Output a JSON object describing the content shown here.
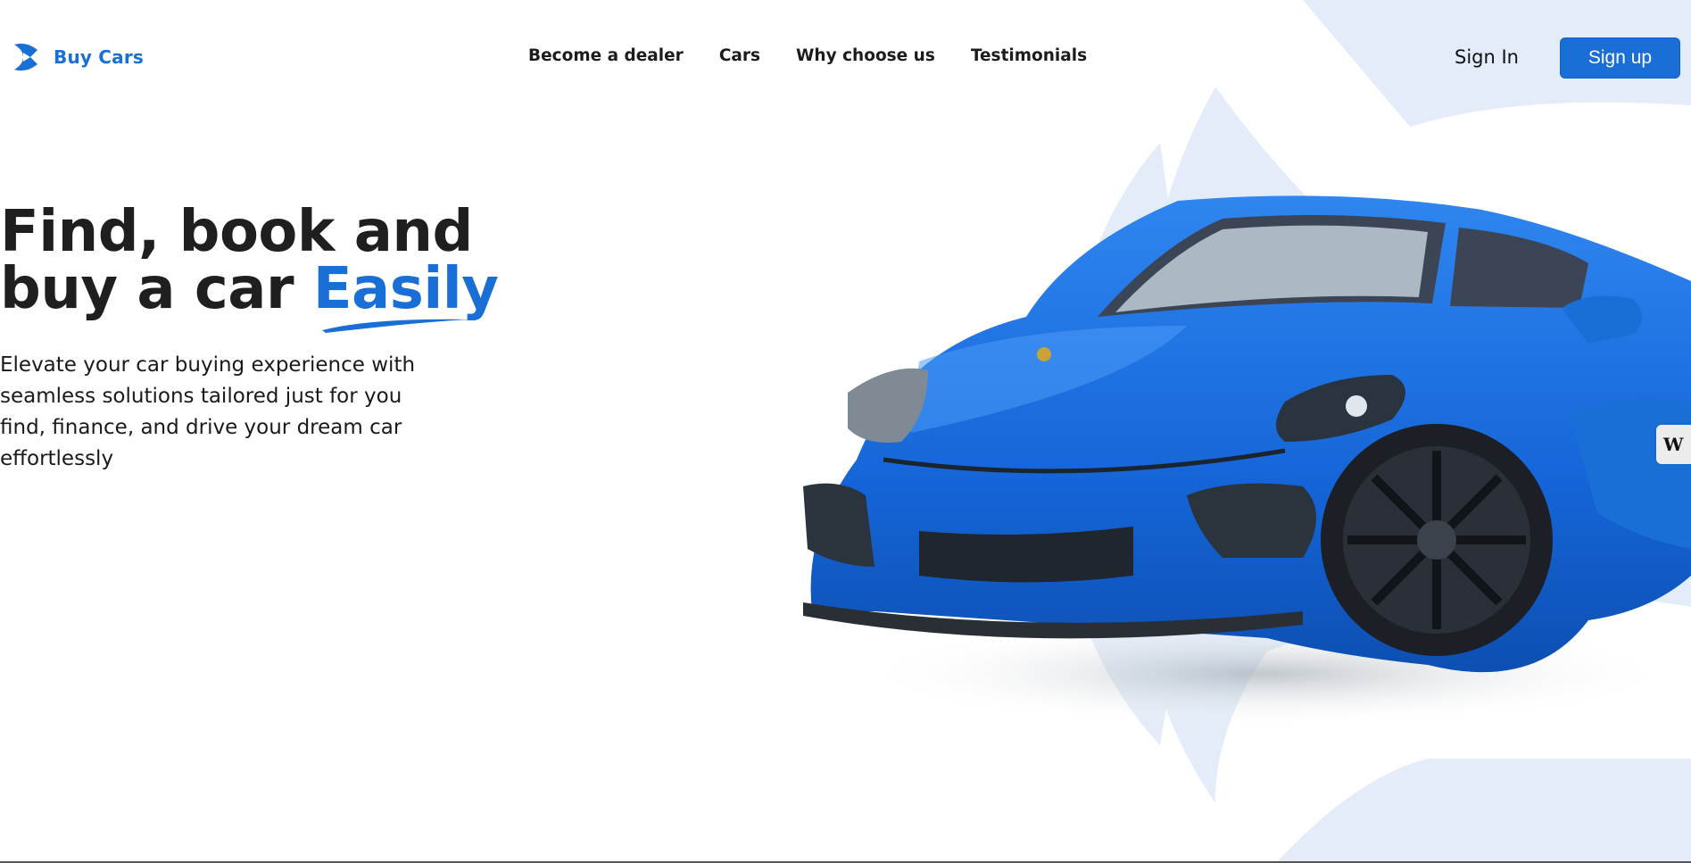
{
  "brand": {
    "name": "Buy Cars",
    "logo_icon": "play-chevron-logo-icon",
    "color": "#1a6fd6"
  },
  "nav": {
    "links": [
      "Become a dealer",
      "Cars",
      "Why choose us",
      "Testimonials"
    ]
  },
  "auth": {
    "signin_label": "Sign In",
    "signup_label": "Sign up"
  },
  "hero": {
    "title_line1": "Find, book and",
    "title_line2_prefix": "buy a car",
    "title_accent": "Easily",
    "subtitle": "Elevate your car buying experience with seamless solutions tailored just for you find, finance, and drive your dream car effortlessly"
  },
  "widget": {
    "label": "W"
  },
  "colors": {
    "accent": "#1a6fd6",
    "background_shape": "#e3ecf8",
    "text": "#1f1f1f"
  }
}
